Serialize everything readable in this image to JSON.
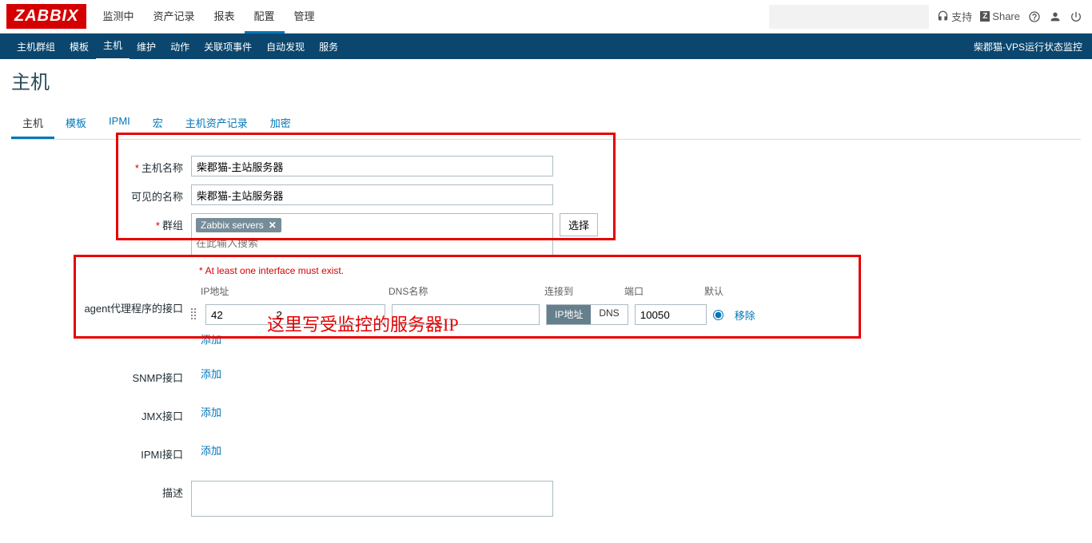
{
  "topnav": {
    "logo": "ZABBIX",
    "items": [
      "监测中",
      "资产记录",
      "报表",
      "配置",
      "管理"
    ],
    "active_index": 3,
    "support": "支持",
    "share_badge": "Z",
    "share": "Share"
  },
  "subnav": {
    "items": [
      "主机群组",
      "模板",
      "主机",
      "维护",
      "动作",
      "关联项事件",
      "自动发现",
      "服务"
    ],
    "active_index": 2,
    "right": "柴郡猫-VPS运行状态监控"
  },
  "page_title": "主机",
  "tabs": {
    "items": [
      "主机",
      "模板",
      "IPMI",
      "宏",
      "主机资产记录",
      "加密"
    ],
    "active_index": 0
  },
  "form": {
    "host_name_label": "主机名称",
    "host_name_value": "柴郡猫-主站服务器",
    "visible_name_label": "可见的名称",
    "visible_name_value": "柴郡猫-主站服务器",
    "groups_label": "群组",
    "groups_pill": "Zabbix servers",
    "groups_placeholder": "在此输入搜索",
    "groups_select_btn": "选择",
    "interface_warn": "At least one interface must exist.",
    "agent_label": "agent代理程序的接口",
    "th_ip": "IP地址",
    "th_dns": "DNS名称",
    "th_conn": "连接到",
    "th_port": "端口",
    "th_default": "默认",
    "agent_ip_value": "42                  2",
    "agent_dns_value": "",
    "conn_ip": "IP地址",
    "conn_dns": "DNS",
    "agent_port_value": "10050",
    "remove_label": "移除",
    "add_label": "添加",
    "snmp_label": "SNMP接口",
    "jmx_label": "JMX接口",
    "ipmi_label": "IPMI接口",
    "descr_label": "描述"
  },
  "annotation": "这里写受监控的服务器IP"
}
